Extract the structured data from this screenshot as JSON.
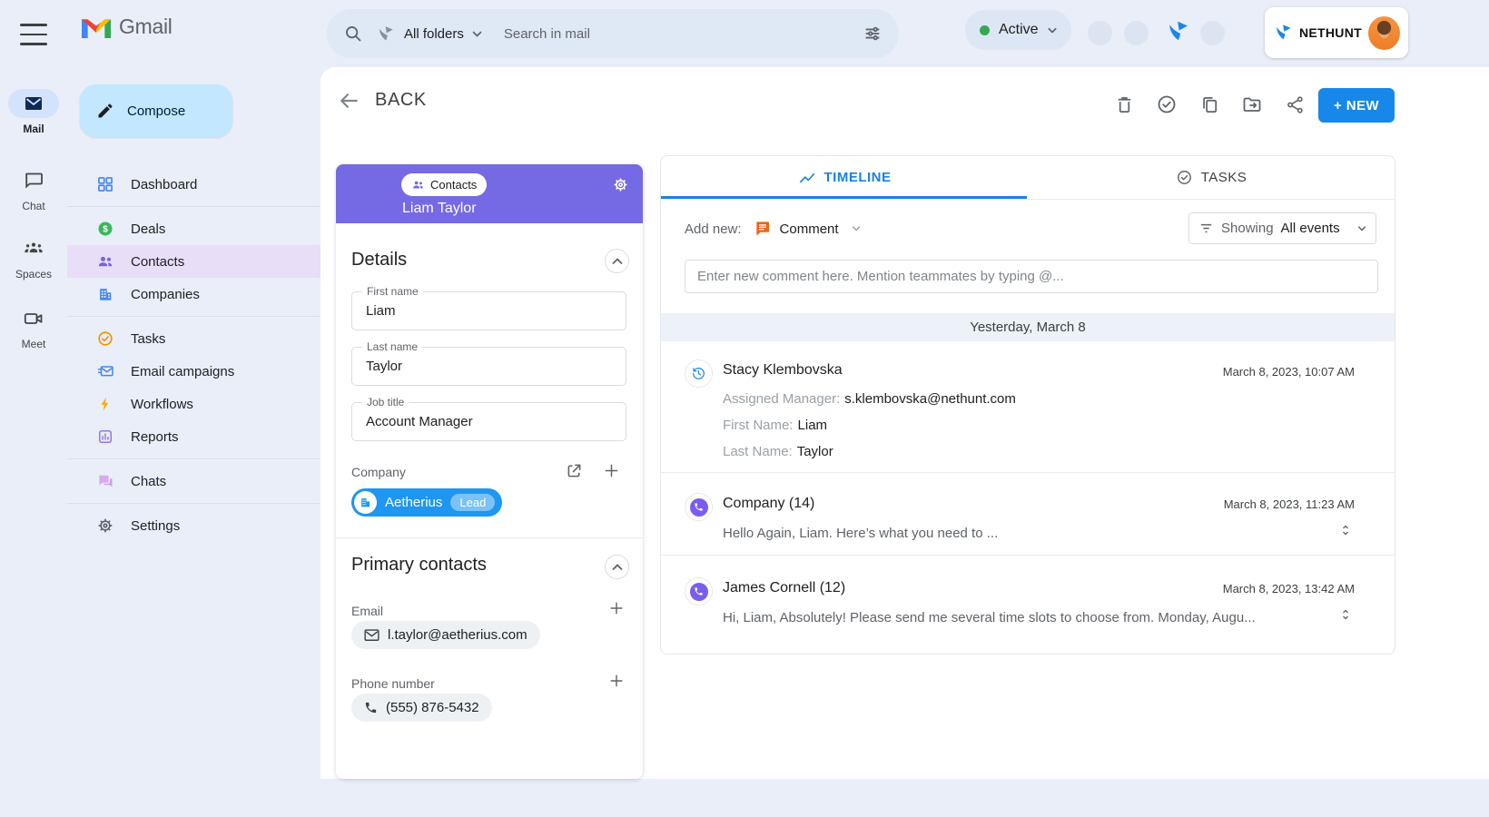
{
  "rail": {
    "items": [
      {
        "label": "Mail"
      },
      {
        "label": "Chat"
      },
      {
        "label": "Spaces"
      },
      {
        "label": "Meet"
      }
    ]
  },
  "sidebar": {
    "logo_text": "Gmail",
    "compose_label": "Compose",
    "items": [
      {
        "label": "Dashboard"
      },
      {
        "label": "Deals"
      },
      {
        "label": "Contacts"
      },
      {
        "label": "Companies"
      },
      {
        "label": "Tasks"
      },
      {
        "label": "Email campaigns"
      },
      {
        "label": "Workflows"
      },
      {
        "label": "Reports"
      },
      {
        "label": "Chats"
      },
      {
        "label": "Settings"
      }
    ]
  },
  "topbar": {
    "folder_filter": "All folders",
    "search_placeholder": "Search in mail",
    "status": "Active",
    "brand": "NetHunt"
  },
  "toolbar": {
    "back_label": "BACK",
    "new_button_label": "+ NEW"
  },
  "contact_card": {
    "record_type": "Contacts",
    "name": "Liam Taylor",
    "details_title": "Details",
    "fields": [
      {
        "label": "First name",
        "value": "Liam"
      },
      {
        "label": "Last name",
        "value": "Taylor"
      },
      {
        "label": "Job title",
        "value": "Account Manager"
      }
    ],
    "company_label": "Company",
    "company_name": "Aetherius",
    "company_badge": "Lead",
    "primary_contacts_title": "Primary contacts",
    "email_label": "Email",
    "email_value": "l.taylor@aetherius.com",
    "phone_label": "Phone number",
    "phone_value": "(555) 876-5432"
  },
  "timeline": {
    "tabs": [
      {
        "label": "TIMELINE"
      },
      {
        "label": "TASKS"
      }
    ],
    "add_new_label": "Add new:",
    "add_new_type": "Comment",
    "filter_prefix": "Showing",
    "filter_value": "All events",
    "comment_placeholder": "Enter new comment here. Mention teammates by typing @...",
    "date_divider": "Yesterday, March 8",
    "entries": [
      {
        "title": "Stacy Klembovska",
        "timestamp": "March 8, 2023, 10:07 AM",
        "fields": [
          {
            "label": "Assigned Manager:",
            "value": "s.klembovska@nethunt.com"
          },
          {
            "label": "First Name:",
            "value": "Liam"
          },
          {
            "label": "Last Name:",
            "value": "Taylor"
          }
        ]
      },
      {
        "title": "Company (14)",
        "timestamp": "March 8, 2023, 11:23 AM",
        "preview": "Hello Again, Liam. Here’s what you need to ..."
      },
      {
        "title": "James Cornell (12)",
        "timestamp": "March 8, 2023, 13:42 AM",
        "preview": "Hi, Liam, Absolutely! Please send me several time slots to choose from. Monday, Augu..."
      }
    ]
  },
  "colors": {
    "accent_blue": "#1a82e2",
    "purple_header": "#7669e4",
    "company_pill_blue": "#1e96f2",
    "lead_badge_blue": "#7ac2f8",
    "active_status_green": "#34a853",
    "sidebar_bg": "#e9eef8"
  }
}
